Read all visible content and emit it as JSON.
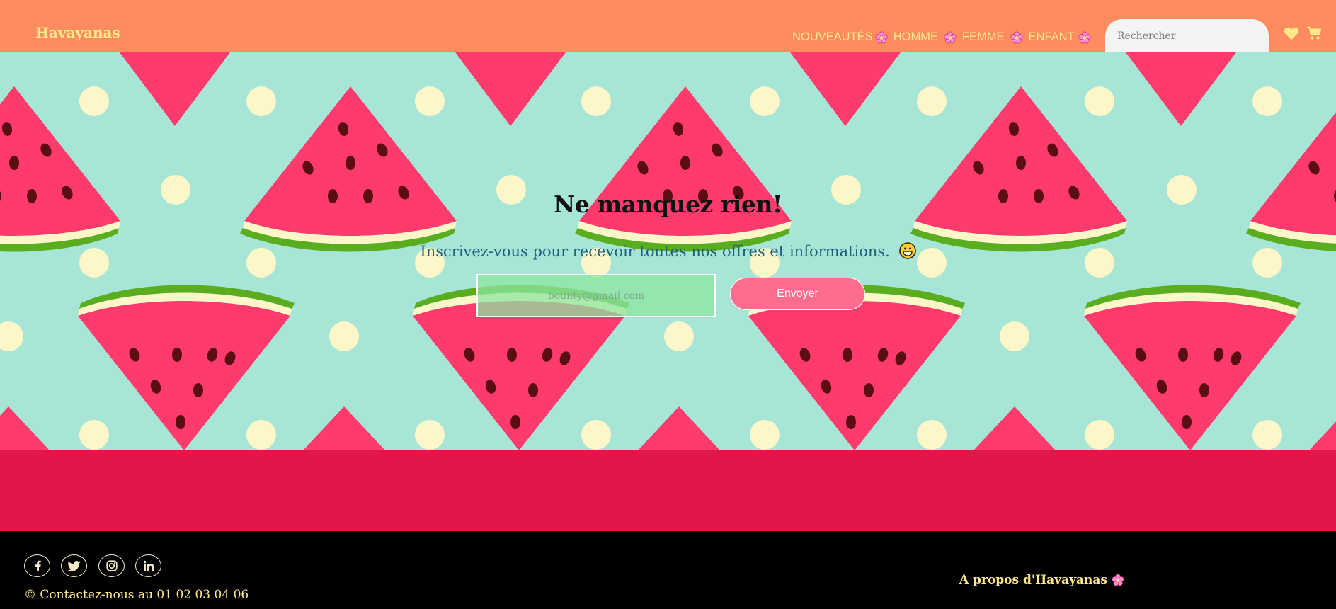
{
  "header": {
    "logo": "Havayanas",
    "nav": [
      {
        "label": "NOUVEAUTÉS"
      },
      {
        "label": "HOMME"
      },
      {
        "label": "FEMME"
      },
      {
        "label": "ENFANT"
      }
    ],
    "search_placeholder": "Rechercher",
    "icons": [
      "heart-icon",
      "cart-icon"
    ]
  },
  "hero": {
    "title": "Ne manquez rien!",
    "subtitle": "Inscrivez-vous pour recevoir toutes nos offres et informations.",
    "email_placeholder": "bounty@gmail.com",
    "send_label": "Envoyer"
  },
  "footer": {
    "social": [
      "facebook-icon",
      "twitter-icon",
      "instagram-icon",
      "linkedin-icon"
    ],
    "contact": "© Contactez-nous au 01 02 03 04 06",
    "about_title": "A propos d'Havayanas"
  },
  "colors": {
    "header": "#ff8c5f",
    "accent_text": "#ffe98a",
    "hero_bg": "#a7e6d7",
    "band": "#e1174a",
    "button": "#ff6d8e"
  }
}
